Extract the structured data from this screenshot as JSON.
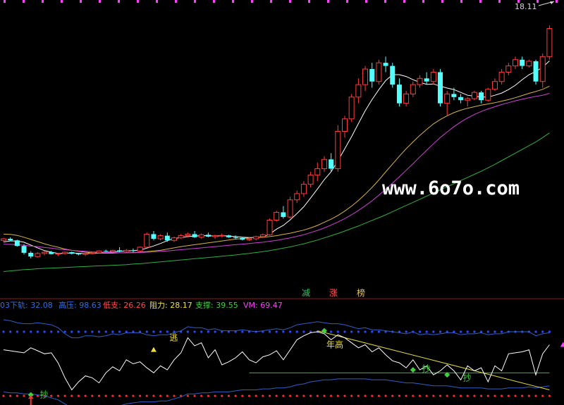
{
  "chart_data": [
    {
      "type": "candlestick",
      "price_label": "18.11",
      "watermark": "www.6o7o.com",
      "badges": [
        {
          "text": "减",
          "color": "#35c26b"
        },
        {
          "text": "涨",
          "color": "#ff5a5a"
        },
        {
          "text": "榜",
          "color": "#e8c070"
        }
      ],
      "candles": [
        [
          1.0,
          1.08,
          0.95,
          1.05
        ],
        [
          1.05,
          1.1,
          0.98,
          1.0
        ],
        [
          1.0,
          1.02,
          0.8,
          0.82
        ],
        [
          0.82,
          0.88,
          0.55,
          0.6
        ],
        [
          0.6,
          0.65,
          0.42,
          0.48
        ],
        [
          0.48,
          0.62,
          0.45,
          0.58
        ],
        [
          0.58,
          0.66,
          0.52,
          0.62
        ],
        [
          0.62,
          0.66,
          0.55,
          0.56
        ],
        [
          0.56,
          0.6,
          0.5,
          0.58
        ],
        [
          0.58,
          0.64,
          0.55,
          0.62
        ],
        [
          0.62,
          0.64,
          0.55,
          0.57
        ],
        [
          0.57,
          0.6,
          0.52,
          0.55
        ],
        [
          0.55,
          0.6,
          0.5,
          0.58
        ],
        [
          0.58,
          0.62,
          0.55,
          0.6
        ],
        [
          0.6,
          0.68,
          0.58,
          0.66
        ],
        [
          0.66,
          0.7,
          0.62,
          0.64
        ],
        [
          0.64,
          0.7,
          0.6,
          0.68
        ],
        [
          0.68,
          0.78,
          0.62,
          0.64
        ],
        [
          0.64,
          0.72,
          0.6,
          0.68
        ],
        [
          0.68,
          0.74,
          0.62,
          0.66
        ],
        [
          0.66,
          0.8,
          0.62,
          0.78
        ],
        [
          0.78,
          1.25,
          0.75,
          1.2
        ],
        [
          1.2,
          1.3,
          1.0,
          1.05
        ],
        [
          1.05,
          1.2,
          1.0,
          1.15
        ],
        [
          1.15,
          1.25,
          0.95,
          1.0
        ],
        [
          1.0,
          1.12,
          0.95,
          1.08
        ],
        [
          1.08,
          1.2,
          1.05,
          1.15
        ],
        [
          1.15,
          1.25,
          1.1,
          1.2
        ],
        [
          1.2,
          1.3,
          1.08,
          1.1
        ],
        [
          1.1,
          1.22,
          1.05,
          1.18
        ],
        [
          1.18,
          1.25,
          1.1,
          1.12
        ],
        [
          1.12,
          1.18,
          1.05,
          1.15
        ],
        [
          1.15,
          1.22,
          1.1,
          1.16
        ],
        [
          1.16,
          1.18,
          1.08,
          1.1
        ],
        [
          1.1,
          1.16,
          1.05,
          1.08
        ],
        [
          1.08,
          1.1,
          1.0,
          1.02
        ],
        [
          1.02,
          1.1,
          0.98,
          1.05
        ],
        [
          1.05,
          1.15,
          1.0,
          1.12
        ],
        [
          1.12,
          1.22,
          1.08,
          1.18
        ],
        [
          1.18,
          1.7,
          1.15,
          1.65
        ],
        [
          1.65,
          1.95,
          1.6,
          1.9
        ],
        [
          1.9,
          2.1,
          1.7,
          1.75
        ],
        [
          1.75,
          2.4,
          1.7,
          2.3
        ],
        [
          2.3,
          2.6,
          2.2,
          2.5
        ],
        [
          2.5,
          2.9,
          2.4,
          2.8
        ],
        [
          2.8,
          3.2,
          2.7,
          3.1
        ],
        [
          3.1,
          3.5,
          2.9,
          3.3
        ],
        [
          3.3,
          3.7,
          3.2,
          3.6
        ],
        [
          3.6,
          3.8,
          3.2,
          3.3
        ],
        [
          3.3,
          4.7,
          3.2,
          4.5
        ],
        [
          4.5,
          5.0,
          4.3,
          4.9
        ],
        [
          4.9,
          5.7,
          4.8,
          5.6
        ],
        [
          5.6,
          6.2,
          5.4,
          6.0
        ],
        [
          6.0,
          6.6,
          5.8,
          6.5
        ],
        [
          6.5,
          6.7,
          5.9,
          6.1
        ],
        [
          6.1,
          6.8,
          6.0,
          6.7
        ],
        [
          6.7,
          6.9,
          6.4,
          6.6
        ],
        [
          6.6,
          6.7,
          5.9,
          6.0
        ],
        [
          6.0,
          6.2,
          5.3,
          5.4
        ],
        [
          5.4,
          5.8,
          5.3,
          5.7
        ],
        [
          5.7,
          6.1,
          5.6,
          6.0
        ],
        [
          6.0,
          6.3,
          5.9,
          6.2
        ],
        [
          6.2,
          6.4,
          6.0,
          6.1
        ],
        [
          6.1,
          6.5,
          6.0,
          6.4
        ],
        [
          6.4,
          6.5,
          5.3,
          5.4
        ],
        [
          5.4,
          5.8,
          5.0,
          5.7
        ],
        [
          5.7,
          5.9,
          5.5,
          5.6
        ],
        [
          5.6,
          5.7,
          5.4,
          5.5
        ],
        [
          5.5,
          5.6,
          5.3,
          5.55
        ],
        [
          5.55,
          5.8,
          5.5,
          5.75
        ],
        [
          5.75,
          5.8,
          5.4,
          5.5
        ],
        [
          5.5,
          5.9,
          5.45,
          5.85
        ],
        [
          5.85,
          6.2,
          5.8,
          6.1
        ],
        [
          6.1,
          6.5,
          6.0,
          6.4
        ],
        [
          6.4,
          6.7,
          6.3,
          6.6
        ],
        [
          6.6,
          6.9,
          6.5,
          6.8
        ],
        [
          6.8,
          6.9,
          6.5,
          6.6
        ],
        [
          6.6,
          6.8,
          6.55,
          6.75
        ],
        [
          6.75,
          6.8,
          6.0,
          6.1
        ],
        [
          6.1,
          7.0,
          5.9,
          6.9
        ],
        [
          6.9,
          7.9,
          6.8,
          7.8
        ]
      ],
      "ma": [
        {
          "color": "#ffffff",
          "values": [
            0.95,
            0.98,
            0.98,
            0.94,
            0.85,
            0.76,
            0.67,
            0.62,
            0.58,
            0.58,
            0.6,
            0.58,
            0.58,
            0.58,
            0.59,
            0.61,
            0.63,
            0.65,
            0.66,
            0.67,
            0.69,
            0.75,
            0.82,
            0.9,
            0.99,
            1.06,
            1.09,
            1.12,
            1.14,
            1.15,
            1.15,
            1.14,
            1.15,
            1.14,
            1.12,
            1.1,
            1.09,
            1.09,
            1.11,
            1.2,
            1.36,
            1.48,
            1.66,
            1.86,
            2.08,
            2.36,
            2.65,
            2.95,
            3.2,
            3.55,
            3.94,
            4.33,
            4.75,
            5.16,
            5.52,
            5.84,
            6.13,
            6.32,
            6.32,
            6.26,
            6.16,
            6.07,
            6.01,
            6.02,
            5.95,
            5.89,
            5.84,
            5.75,
            5.66,
            5.63,
            5.6,
            5.6,
            5.66,
            5.73,
            5.84,
            5.98,
            6.16,
            6.32,
            6.42,
            6.56,
            6.76
          ]
        },
        {
          "color": "#d9b444",
          "values": [
            1.2,
            1.19,
            1.16,
            1.1,
            1.03,
            0.96,
            0.89,
            0.83,
            0.78,
            0.72,
            0.68,
            0.65,
            0.62,
            0.6,
            0.59,
            0.59,
            0.59,
            0.6,
            0.6,
            0.61,
            0.62,
            0.64,
            0.66,
            0.68,
            0.72,
            0.76,
            0.8,
            0.83,
            0.86,
            0.89,
            0.92,
            0.95,
            0.98,
            1.01,
            1.04,
            1.06,
            1.08,
            1.09,
            1.1,
            1.12,
            1.15,
            1.19,
            1.23,
            1.28,
            1.33,
            1.4,
            1.48,
            1.58,
            1.68,
            1.8,
            1.94,
            2.1,
            2.28,
            2.48,
            2.7,
            2.94,
            3.2,
            3.45,
            3.7,
            3.94,
            4.16,
            4.37,
            4.56,
            4.74,
            4.88,
            5.0,
            5.1,
            5.18,
            5.24,
            5.29,
            5.34,
            5.38,
            5.42,
            5.47,
            5.52,
            5.58,
            5.65,
            5.72,
            5.78,
            5.85,
            5.95
          ]
        },
        {
          "color": "#d040d8",
          "values": [
            0.88,
            0.87,
            0.86,
            0.84,
            0.82,
            0.8,
            0.77,
            0.75,
            0.72,
            0.7,
            0.68,
            0.66,
            0.65,
            0.63,
            0.62,
            0.61,
            0.61,
            0.6,
            0.6,
            0.6,
            0.61,
            0.62,
            0.63,
            0.65,
            0.66,
            0.68,
            0.7,
            0.72,
            0.74,
            0.76,
            0.78,
            0.8,
            0.82,
            0.84,
            0.86,
            0.88,
            0.9,
            0.92,
            0.94,
            0.97,
            1.0,
            1.04,
            1.08,
            1.13,
            1.18,
            1.25,
            1.32,
            1.4,
            1.49,
            1.59,
            1.7,
            1.82,
            1.96,
            2.11,
            2.27,
            2.45,
            2.64,
            2.84,
            3.04,
            3.25,
            3.46,
            3.68,
            3.89,
            4.1,
            4.3,
            4.48,
            4.65,
            4.8,
            4.93,
            5.04,
            5.14,
            5.22,
            5.29,
            5.36,
            5.42,
            5.48,
            5.53,
            5.58,
            5.62,
            5.66,
            5.72
          ]
        },
        {
          "color": "#30b040",
          "values": [
            0.0,
            0.02,
            0.04,
            0.06,
            0.07,
            0.09,
            0.1,
            0.11,
            0.12,
            0.13,
            0.14,
            0.15,
            0.16,
            0.17,
            0.18,
            0.19,
            0.2,
            0.21,
            0.22,
            0.24,
            0.25,
            0.27,
            0.29,
            0.31,
            0.33,
            0.35,
            0.37,
            0.39,
            0.41,
            0.43,
            0.45,
            0.47,
            0.49,
            0.51,
            0.53,
            0.56,
            0.58,
            0.61,
            0.64,
            0.67,
            0.71,
            0.75,
            0.79,
            0.84,
            0.89,
            0.95,
            1.01,
            1.08,
            1.15,
            1.22,
            1.3,
            1.38,
            1.46,
            1.55,
            1.64,
            1.73,
            1.82,
            1.92,
            2.02,
            2.12,
            2.22,
            2.32,
            2.42,
            2.52,
            2.62,
            2.72,
            2.82,
            2.92,
            3.02,
            3.12,
            3.22,
            3.33,
            3.44,
            3.56,
            3.68,
            3.8,
            3.92,
            4.04,
            4.16,
            4.3,
            4.45
          ]
        }
      ],
      "ylim": [
        -0.6,
        8.4
      ]
    },
    {
      "type": "line",
      "header": [
        {
          "text": "03",
          "color": "#2f6fe0"
        },
        {
          "text": "下轨: 32.08",
          "color": "#2f6fe0"
        },
        {
          "text": "高压: 98.63",
          "color": "#2f6fe0"
        },
        {
          "text": "低支: 26.26",
          "color": "#ff4a4a"
        },
        {
          "text": "阻力: 28.17",
          "color": "#f0e040"
        },
        {
          "text": "支撑: 39.55",
          "color": "#40d040"
        },
        {
          "text": "VM: 69.47",
          "color": "#ff40ff"
        }
      ],
      "osc": [
        78,
        77,
        76,
        75,
        80,
        77,
        74,
        75,
        65,
        50,
        38,
        46,
        52,
        50,
        45,
        55,
        61,
        57,
        68,
        64,
        66,
        60,
        55,
        62,
        58,
        68,
        75,
        90,
        82,
        85,
        70,
        78,
        63,
        66,
        70,
        76,
        68,
        65,
        71,
        73,
        77,
        68,
        78,
        88,
        92,
        95,
        96,
        94,
        88,
        93,
        90,
        85,
        80,
        83,
        76,
        80,
        73,
        67,
        65,
        60,
        68,
        58,
        62,
        53,
        57,
        63,
        57,
        48,
        62,
        57,
        60,
        46,
        62,
        57,
        74,
        75,
        76,
        78,
        53,
        74,
        83
      ],
      "upper": [
        108,
        107,
        105,
        104,
        104,
        105,
        104,
        103,
        100,
        94,
        90,
        90,
        92,
        92,
        91,
        92,
        94,
        93,
        95,
        95,
        95,
        93,
        92,
        93,
        93,
        95,
        97,
        101,
        100,
        100,
        98,
        99,
        97,
        97,
        97,
        98,
        97,
        96,
        97,
        98,
        99,
        98,
        100,
        103,
        104,
        105,
        106,
        105,
        104,
        104,
        103,
        101,
        99,
        100,
        98,
        98,
        97,
        96,
        95,
        94,
        96,
        93,
        94,
        93,
        94,
        95,
        95,
        93,
        94,
        94,
        95,
        93,
        94,
        94,
        96,
        96,
        96,
        96,
        92,
        94,
        95
      ],
      "lower": [
        36,
        35,
        35,
        34,
        34,
        33,
        32,
        30,
        28,
        24,
        20,
        19,
        18,
        18,
        19,
        20,
        22,
        22,
        24,
        25,
        26,
        26,
        26,
        27,
        27,
        29,
        31,
        34,
        34,
        35,
        35,
        36,
        36,
        36,
        37,
        38,
        38,
        38,
        39,
        39,
        40,
        40,
        41,
        43,
        44,
        46,
        47,
        48,
        48,
        49,
        49,
        49,
        49,
        49,
        48,
        48,
        48,
        47,
        46,
        45,
        45,
        44,
        43,
        42,
        42,
        42,
        41,
        40,
        40,
        40,
        40,
        39,
        39,
        39,
        40,
        40,
        40,
        41,
        40,
        41,
        42
      ],
      "support_level": 55,
      "ylim": [
        25,
        115
      ],
      "dot_high": 96,
      "dot_low": 32,
      "resistance_line": [
        [
          46,
          97
        ],
        [
          80,
          38
        ]
      ],
      "labels": [
        {
          "text": "逃",
          "color": "#f0e040",
          "i": 24,
          "y": 90
        },
        {
          "text": "年高",
          "color": "#f0e040",
          "i": 47,
          "y": 83
        },
        {
          "text": "抄",
          "color": "#40d040",
          "i": 5,
          "y": 33
        },
        {
          "text": "抄",
          "color": "#40d040",
          "i": 61,
          "y": 59
        },
        {
          "text": "抄",
          "color": "#40d040",
          "i": 67,
          "y": 50
        }
      ],
      "markers": [
        {
          "shape": "tri-up",
          "color": "#f0e040",
          "i": 22,
          "y": 78
        },
        {
          "shape": "tri-up",
          "color": "#ff40ff",
          "i": 82,
          "y": 83
        },
        {
          "shape": "diamond",
          "color": "#40d040",
          "i": 47,
          "y": 97
        },
        {
          "shape": "diamond",
          "color": "#40d040",
          "i": 60,
          "y": 58
        },
        {
          "shape": "diamond",
          "color": "#40d040",
          "i": 65,
          "y": 53
        },
        {
          "shape": "diamond",
          "color": "#40d040",
          "i": 4,
          "y": 33
        },
        {
          "shape": "arrow-up",
          "color": "#ff3030",
          "i": 4,
          "y": 27
        }
      ]
    }
  ]
}
